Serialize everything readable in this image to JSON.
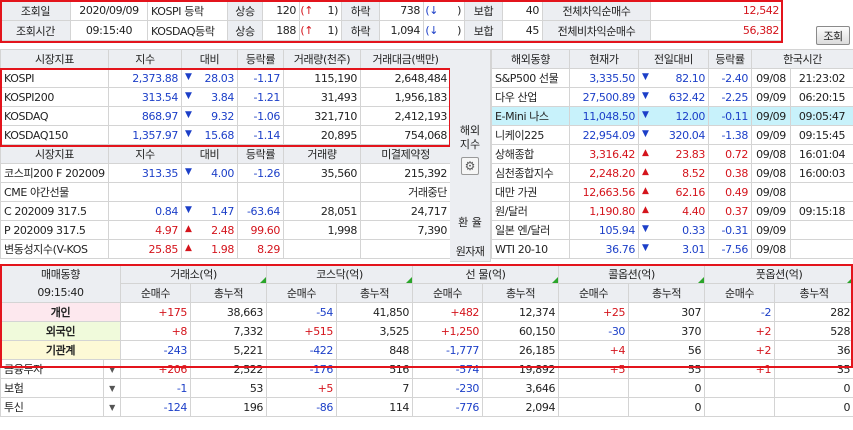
{
  "top": {
    "r1": {
      "label": "조회일",
      "value": "2020/09/09",
      "market": "KOSPI 등락",
      "up_lbl": "상승",
      "up": "120",
      "upmark": "(↑",
      "upcnt": "1)",
      "down_lbl": "하락",
      "down": "738",
      "downmark": "(↓",
      "downend": ")",
      "flat_lbl": "보합",
      "flat": "40",
      "prog_lbl": "전체차익순매수",
      "prog": "12,542"
    },
    "r2": {
      "label": "조회시간",
      "value": "09:15:40",
      "market": "KOSDAQ등락",
      "up_lbl": "상승",
      "up": "188",
      "upmark": "(↑",
      "upcnt": "1)",
      "down_lbl": "하락",
      "down": "1,094",
      "downmark": "(↓",
      "downend": ")",
      "flat_lbl": "보합",
      "flat": "45",
      "prog_lbl": "전체비차익순매수",
      "prog": "56,382"
    },
    "refresh_label": "조회"
  },
  "left": {
    "headers": [
      "시장지표",
      "지수",
      "대비",
      "등락률",
      "거래량(천주)",
      "거래대금(백만)"
    ],
    "rows": [
      {
        "name": "KOSPI",
        "idx": "2,373.88",
        "ar": "▼",
        "chg": "28.03",
        "rate": "-1.17",
        "vol": "115,190",
        "amt": "2,648,484"
      },
      {
        "name": "KOSPI200",
        "idx": "313.54",
        "ar": "▼",
        "chg": "3.84",
        "rate": "-1.21",
        "vol": "31,493",
        "amt": "1,956,183"
      },
      {
        "name": "KOSDAQ",
        "idx": "868.97",
        "ar": "▼",
        "chg": "9.32",
        "rate": "-1.06",
        "vol": "321,710",
        "amt": "2,412,193"
      },
      {
        "name": "KOSDAQ150",
        "idx": "1,357.97",
        "ar": "▼",
        "chg": "15.68",
        "rate": "-1.14",
        "vol": "20,895",
        "amt": "754,068"
      }
    ],
    "headers2": [
      "시장지표",
      "지수",
      "대비",
      "등락률",
      "거래량",
      "미결제약정"
    ],
    "rows2": [
      {
        "name": "코스피200 F 202009",
        "idx": "313.35",
        "ar": "▼",
        "chg": "4.00",
        "rate": "-1.26",
        "vol": "35,560",
        "amt": "215,392",
        "dir": "dn"
      },
      {
        "name": "CME 야간선물",
        "idx": "",
        "ar": "",
        "chg": "",
        "rate": "",
        "vol": "",
        "amt": "거래중단",
        "dir": ""
      },
      {
        "name": "C 202009 317.5",
        "idx": "0.84",
        "ar": "▼",
        "chg": "1.47",
        "rate": "-63.64",
        "vol": "28,051",
        "amt": "24,717",
        "dir": "dn"
      },
      {
        "name": "P 202009 317.5",
        "idx": "4.97",
        "ar": "▲",
        "chg": "2.48",
        "rate": "99.60",
        "vol": "1,998",
        "amt": "7,390",
        "dir": "up"
      },
      {
        "name": "변동성지수(V-KOS",
        "idx": "25.85",
        "ar": "▲",
        "chg": "1.98",
        "rate": "8.29",
        "vol": "",
        "amt": "",
        "dir": "up"
      }
    ]
  },
  "mid": {
    "line1": "해외",
    "line2": "지수",
    "gear": "⚙",
    "fx": "환 율",
    "tool": "원자재"
  },
  "right": {
    "headers": [
      "해외동향",
      "현재가",
      "전일대비",
      "등락률",
      "한국시간"
    ],
    "rows": [
      {
        "name": "S&P500 선물",
        "price": "3,335.50",
        "ar": "▼",
        "chg": "82.10",
        "rate": "-2.40",
        "date": "09/08",
        "time": "21:23:02",
        "dir": "dn",
        "hl": false
      },
      {
        "name": "다우 산업",
        "price": "27,500.89",
        "ar": "▼",
        "chg": "632.42",
        "rate": "-2.25",
        "date": "09/09",
        "time": "06:20:15",
        "dir": "dn",
        "hl": false
      },
      {
        "name": "E-Mini 나스",
        "price": "11,048.50",
        "ar": "▼",
        "chg": "12.00",
        "rate": "-0.11",
        "date": "09/09",
        "time": "09:05:47",
        "dir": "dn",
        "hl": true
      },
      {
        "name": "니케이225",
        "price": "22,954.09",
        "ar": "▼",
        "chg": "320.04",
        "rate": "-1.38",
        "date": "09/09",
        "time": "09:15:45",
        "dir": "dn",
        "hl": false
      },
      {
        "name": "상해종합",
        "price": "3,316.42",
        "ar": "▲",
        "chg": "23.83",
        "rate": "0.72",
        "date": "09/08",
        "time": "16:01:04",
        "dir": "up",
        "hl": false
      },
      {
        "name": "심천종합지수",
        "price": "2,248.20",
        "ar": "▲",
        "chg": "8.52",
        "rate": "0.38",
        "date": "09/08",
        "time": "16:00:03",
        "dir": "up",
        "hl": false
      },
      {
        "name": "대만 가권",
        "price": "12,663.56",
        "ar": "▲",
        "chg": "62.16",
        "rate": "0.49",
        "date": "09/08",
        "time": "",
        "dir": "up",
        "hl": false
      },
      {
        "name": "원/달러",
        "price": "1,190.80",
        "ar": "▲",
        "chg": "4.40",
        "rate": "0.37",
        "date": "09/09",
        "time": "09:15:18",
        "dir": "up",
        "hl": false
      },
      {
        "name": "일본 엔/달러",
        "price": "105.94",
        "ar": "▼",
        "chg": "0.33",
        "rate": "-0.31",
        "date": "09/09",
        "time": "",
        "dir": "dn",
        "hl": false
      },
      {
        "name": "WTI 20-10",
        "price": "36.76",
        "ar": "▼",
        "chg": "3.01",
        "rate": "-7.56",
        "date": "09/08",
        "time": "",
        "dir": "dn",
        "hl": false
      }
    ]
  },
  "bottom": {
    "title": "매매동향",
    "time": "09:15:40",
    "groups": [
      "거래소(억)",
      "코스닥(억)",
      "선 물(억)",
      "콜옵션(억)",
      "풋옵션(억)"
    ],
    "sub_net": "순매수",
    "sub_total": "총누적",
    "rows": [
      {
        "name": "개인",
        "cls": "pk",
        "vals": [
          "+175",
          "38,663",
          "-54",
          "41,850",
          "+482",
          "12,374",
          "+25",
          "307",
          "-2",
          "282"
        ]
      },
      {
        "name": "외국인",
        "cls": "gr",
        "vals": [
          "+8",
          "7,332",
          "+515",
          "3,525",
          "+1,250",
          "60,150",
          "-30",
          "370",
          "+2",
          "528"
        ]
      },
      {
        "name": "기관계",
        "cls": "yw",
        "vals": [
          "-243",
          "5,221",
          "-422",
          "848",
          "-1,777",
          "26,185",
          "+4",
          "56",
          "+2",
          "36"
        ]
      },
      {
        "name": "금융투자",
        "cls": "",
        "vals": [
          "+206",
          "2,522",
          "-176",
          "516",
          "-574",
          "19,892",
          "+5",
          "55",
          "+1",
          "35"
        ]
      },
      {
        "name": "보험",
        "cls": "",
        "vals": [
          "-1",
          "53",
          "+5",
          "7",
          "-230",
          "3,646",
          "",
          "0",
          "",
          "0"
        ]
      },
      {
        "name": "투신",
        "cls": "",
        "vals": [
          "-124",
          "196",
          "-86",
          "114",
          "-776",
          "2,094",
          "",
          "0",
          "",
          "0"
        ]
      }
    ],
    "dd_icon": "▼"
  },
  "colors": {
    "up": "#d4141c",
    "down": "#1c3fc8",
    "highlight_border": "#e3141c",
    "cyan": "#c8f2fb"
  }
}
